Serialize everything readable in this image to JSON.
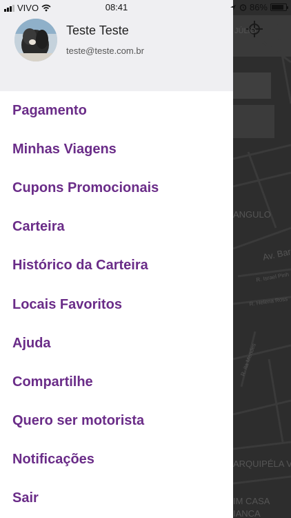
{
  "status_bar": {
    "carrier": "VIVO",
    "time": "08:41",
    "battery": "86%",
    "battery_level": 0.86
  },
  "profile": {
    "name": "Teste Teste",
    "email": "teste@teste.com.br"
  },
  "menu": {
    "items": [
      {
        "label": "Pagamento"
      },
      {
        "label": "Minhas Viagens"
      },
      {
        "label": "Cupons Promocionais"
      },
      {
        "label": "Carteira"
      },
      {
        "label": "Histórico da Carteira"
      },
      {
        "label": "Locais Favoritos"
      },
      {
        "label": "Ajuda"
      },
      {
        "label": "Compartilhe"
      },
      {
        "label": "Quero ser motorista"
      },
      {
        "label": "Notificações"
      },
      {
        "label": "Sair"
      }
    ]
  },
  "map": {
    "labels": [
      "JÚLIO",
      "ANGULO",
      "Av. Bar",
      "R. Israel Pinh",
      "R. Helena Ross",
      "R. Ita Mendes",
      "ARQUIPÉLA VERDE",
      "IM CASA",
      "IANCA"
    ]
  },
  "colors": {
    "menu_text": "#6a2c88",
    "header_bg": "#efeff2",
    "map_bg": "#2b2b2b"
  }
}
